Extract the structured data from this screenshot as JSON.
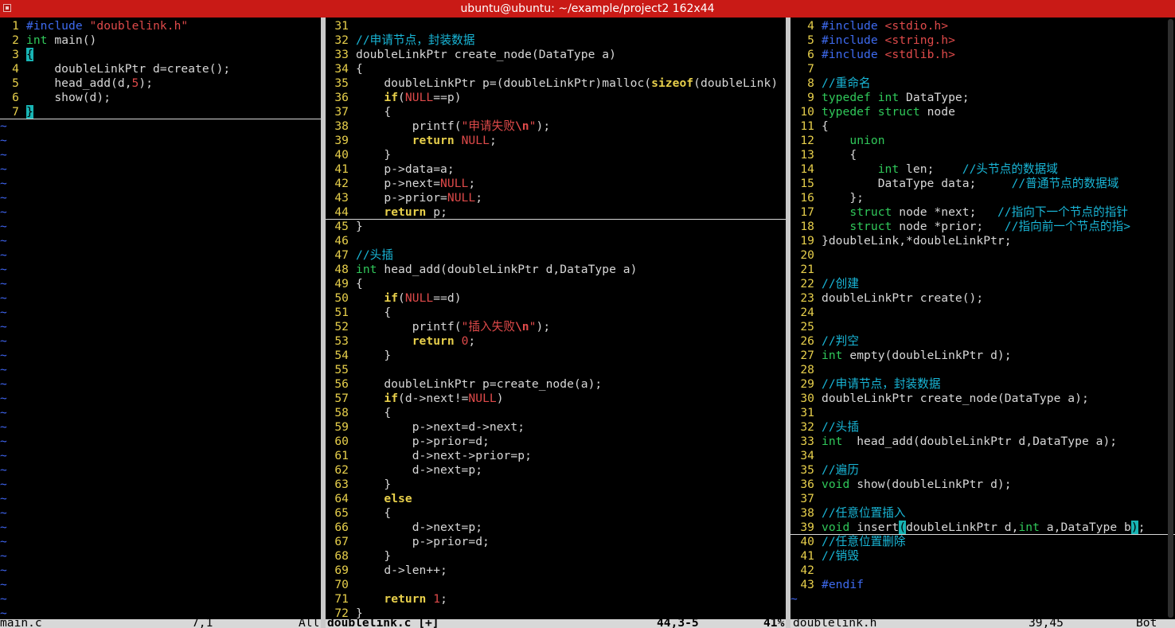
{
  "window": {
    "title": "ubuntu@ubuntu: ~/example/project2 162x44"
  },
  "colors": {
    "titlebar": "#c91a16",
    "number": "#e7cf4b",
    "preproc": "#3e6bf0",
    "keyword": "#e7cf4b",
    "type": "#30c85a",
    "string": "#df4a4a",
    "comment": "#19b7d8",
    "constant": "#df4a4a",
    "tilde": "#3e64f0",
    "cursor": "#18b4b4",
    "default": "#d8d8d8"
  },
  "panes": [
    {
      "id": "main",
      "status": {
        "file": "main.c",
        "pos": "7,1",
        "pct": "All",
        "active": false
      },
      "lines": [
        {
          "n": "1",
          "t": [
            [
              "pp",
              "#include"
            ],
            [
              "d",
              " "
            ],
            [
              "str",
              "\"doublelink.h\""
            ]
          ]
        },
        {
          "n": "2",
          "t": [
            [
              "ty",
              "int"
            ],
            [
              "d",
              " main()"
            ]
          ]
        },
        {
          "n": "3",
          "t": [
            [
              "cur",
              "{"
            ]
          ]
        },
        {
          "n": "4",
          "t": [
            [
              "d",
              "    doubleLinkPtr d=create();"
            ]
          ]
        },
        {
          "n": "5",
          "t": [
            [
              "d",
              "    head_add(d,"
            ],
            [
              "num",
              "5"
            ],
            [
              "d",
              ");"
            ]
          ]
        },
        {
          "n": "6",
          "t": [
            [
              "d",
              "    show(d);"
            ]
          ]
        },
        {
          "n": "7",
          "t": [
            [
              "cur",
              "}"
            ]
          ]
        }
      ]
    },
    {
      "id": "doublelink_c",
      "status": {
        "file": "doublelink.c [+]",
        "pos": "44,3-5",
        "pct": "41%",
        "active": true
      },
      "lines": [
        {
          "n": "31",
          "t": []
        },
        {
          "n": "32",
          "t": [
            [
              "cm",
              "//申请节点，封装数据"
            ]
          ]
        },
        {
          "n": "33",
          "t": [
            [
              "d",
              "doubleLinkPtr create_node(DataType a)"
            ]
          ]
        },
        {
          "n": "34",
          "t": [
            [
              "d",
              "{"
            ]
          ]
        },
        {
          "n": "35",
          "t": [
            [
              "d",
              "    doubleLinkPtr p=(doubleLinkPtr)malloc("
            ],
            [
              "kw",
              "sizeof"
            ],
            [
              "d",
              "(doubleLink)"
            ]
          ]
        },
        {
          "n": "36",
          "t": [
            [
              "d",
              "    "
            ],
            [
              "kw",
              "if"
            ],
            [
              "d",
              "("
            ],
            [
              "cst",
              "NULL"
            ],
            [
              "d",
              "==p)"
            ]
          ]
        },
        {
          "n": "37",
          "t": [
            [
              "d",
              "    {"
            ]
          ]
        },
        {
          "n": "38",
          "t": [
            [
              "d",
              "        printf("
            ],
            [
              "str",
              "\"申请失败"
            ],
            [
              "sp",
              "\\n"
            ],
            [
              "str",
              "\""
            ],
            [
              "d",
              ");"
            ]
          ]
        },
        {
          "n": "39",
          "t": [
            [
              "d",
              "        "
            ],
            [
              "kw",
              "return"
            ],
            [
              "d",
              " "
            ],
            [
              "cst",
              "NULL"
            ],
            [
              "d",
              ";"
            ]
          ]
        },
        {
          "n": "40",
          "t": [
            [
              "d",
              "    }"
            ]
          ]
        },
        {
          "n": "41",
          "t": [
            [
              "d",
              "    p->data=a;"
            ]
          ]
        },
        {
          "n": "42",
          "t": [
            [
              "d",
              "    p->next="
            ],
            [
              "cst",
              "NULL"
            ],
            [
              "d",
              ";"
            ]
          ]
        },
        {
          "n": "43",
          "t": [
            [
              "d",
              "    p->prior="
            ],
            [
              "cst",
              "NULL"
            ],
            [
              "d",
              ";"
            ]
          ]
        },
        {
          "n": "44",
          "t": [
            [
              "d",
              "    "
            ],
            [
              "kw",
              "return"
            ],
            [
              "d",
              " p;"
            ]
          ]
        },
        {
          "n": "45",
          "t": [
            [
              "d",
              "}"
            ]
          ]
        },
        {
          "n": "46",
          "t": []
        },
        {
          "n": "47",
          "t": [
            [
              "cm",
              "//头插"
            ]
          ]
        },
        {
          "n": "48",
          "t": [
            [
              "ty",
              "int"
            ],
            [
              "d",
              " head_add(doubleLinkPtr d,DataType a)"
            ]
          ]
        },
        {
          "n": "49",
          "t": [
            [
              "d",
              "{"
            ]
          ]
        },
        {
          "n": "50",
          "t": [
            [
              "d",
              "    "
            ],
            [
              "kw",
              "if"
            ],
            [
              "d",
              "("
            ],
            [
              "cst",
              "NULL"
            ],
            [
              "d",
              "==d)"
            ]
          ]
        },
        {
          "n": "51",
          "t": [
            [
              "d",
              "    {"
            ]
          ]
        },
        {
          "n": "52",
          "t": [
            [
              "d",
              "        printf("
            ],
            [
              "str",
              "\"插入失败"
            ],
            [
              "sp",
              "\\n"
            ],
            [
              "str",
              "\""
            ],
            [
              "d",
              ");"
            ]
          ]
        },
        {
          "n": "53",
          "t": [
            [
              "d",
              "        "
            ],
            [
              "kw",
              "return"
            ],
            [
              "d",
              " "
            ],
            [
              "num",
              "0"
            ],
            [
              "d",
              ";"
            ]
          ]
        },
        {
          "n": "54",
          "t": [
            [
              "d",
              "    }"
            ]
          ]
        },
        {
          "n": "55",
          "t": []
        },
        {
          "n": "56",
          "t": [
            [
              "d",
              "    doubleLinkPtr p=create_node(a);"
            ]
          ]
        },
        {
          "n": "57",
          "t": [
            [
              "d",
              "    "
            ],
            [
              "kw",
              "if"
            ],
            [
              "d",
              "(d->next!="
            ],
            [
              "cst",
              "NULL"
            ],
            [
              "d",
              ")"
            ]
          ]
        },
        {
          "n": "58",
          "t": [
            [
              "d",
              "    {"
            ]
          ]
        },
        {
          "n": "59",
          "t": [
            [
              "d",
              "        p->next=d->next;"
            ]
          ]
        },
        {
          "n": "60",
          "t": [
            [
              "d",
              "        p->prior=d;"
            ]
          ]
        },
        {
          "n": "61",
          "t": [
            [
              "d",
              "        d->next->prior=p;"
            ]
          ]
        },
        {
          "n": "62",
          "t": [
            [
              "d",
              "        d->next=p;"
            ]
          ]
        },
        {
          "n": "63",
          "t": [
            [
              "d",
              "    }"
            ]
          ]
        },
        {
          "n": "64",
          "t": [
            [
              "d",
              "    "
            ],
            [
              "kw",
              "else"
            ]
          ]
        },
        {
          "n": "65",
          "t": [
            [
              "d",
              "    {"
            ]
          ]
        },
        {
          "n": "66",
          "t": [
            [
              "d",
              "        d->next=p;"
            ]
          ]
        },
        {
          "n": "67",
          "t": [
            [
              "d",
              "        p->prior=d;"
            ]
          ]
        },
        {
          "n": "68",
          "t": [
            [
              "d",
              "    }"
            ]
          ]
        },
        {
          "n": "69",
          "t": [
            [
              "d",
              "    d->len++;"
            ]
          ]
        },
        {
          "n": "70",
          "t": []
        },
        {
          "n": "71",
          "t": [
            [
              "d",
              "    "
            ],
            [
              "kw",
              "return"
            ],
            [
              "d",
              " "
            ],
            [
              "num",
              "1"
            ],
            [
              "d",
              ";"
            ]
          ]
        },
        {
          "n": "72",
          "t": [
            [
              "d",
              "}"
            ]
          ]
        }
      ]
    },
    {
      "id": "doublelink_h",
      "status": {
        "file": "doublelink.h",
        "pos": "39,45",
        "pct": "Bot",
        "active": false
      },
      "lines": [
        {
          "n": "4",
          "t": [
            [
              "pp",
              "#include"
            ],
            [
              "d",
              " "
            ],
            [
              "str",
              "<stdio.h>"
            ]
          ]
        },
        {
          "n": "5",
          "t": [
            [
              "pp",
              "#include"
            ],
            [
              "d",
              " "
            ],
            [
              "str",
              "<string.h>"
            ]
          ]
        },
        {
          "n": "6",
          "t": [
            [
              "pp",
              "#include"
            ],
            [
              "d",
              " "
            ],
            [
              "str",
              "<stdlib.h>"
            ]
          ]
        },
        {
          "n": "7",
          "t": []
        },
        {
          "n": "8",
          "t": [
            [
              "cm",
              "//重命名"
            ]
          ]
        },
        {
          "n": "9",
          "t": [
            [
              "ty",
              "typedef"
            ],
            [
              "d",
              " "
            ],
            [
              "ty",
              "int"
            ],
            [
              "d",
              " DataType;"
            ]
          ]
        },
        {
          "n": "10",
          "t": [
            [
              "ty",
              "typedef"
            ],
            [
              "d",
              " "
            ],
            [
              "ty",
              "struct"
            ],
            [
              "d",
              " node"
            ]
          ]
        },
        {
          "n": "11",
          "t": [
            [
              "d",
              "{"
            ]
          ]
        },
        {
          "n": "12",
          "t": [
            [
              "d",
              "    "
            ],
            [
              "ty",
              "union"
            ]
          ]
        },
        {
          "n": "13",
          "t": [
            [
              "d",
              "    {"
            ]
          ]
        },
        {
          "n": "14",
          "t": [
            [
              "d",
              "        "
            ],
            [
              "ty",
              "int"
            ],
            [
              "d",
              " len;    "
            ],
            [
              "cm",
              "//头节点的数据域"
            ]
          ]
        },
        {
          "n": "15",
          "t": [
            [
              "d",
              "        DataType data;     "
            ],
            [
              "cm",
              "//普通节点的数据域"
            ]
          ]
        },
        {
          "n": "16",
          "t": [
            [
              "d",
              "    };"
            ]
          ]
        },
        {
          "n": "17",
          "t": [
            [
              "d",
              "    "
            ],
            [
              "ty",
              "struct"
            ],
            [
              "d",
              " node *next;   "
            ],
            [
              "cm",
              "//指向下一个节点的指针"
            ]
          ]
        },
        {
          "n": "18",
          "t": [
            [
              "d",
              "    "
            ],
            [
              "ty",
              "struct"
            ],
            [
              "d",
              " node *prior;   "
            ],
            [
              "cm",
              "//指向前一个节点的指>"
            ]
          ]
        },
        {
          "n": "19",
          "t": [
            [
              "d",
              "}doubleLink,*doubleLinkPtr;"
            ]
          ]
        },
        {
          "n": "20",
          "t": []
        },
        {
          "n": "21",
          "t": []
        },
        {
          "n": "22",
          "t": [
            [
              "cm",
              "//创建"
            ]
          ]
        },
        {
          "n": "23",
          "t": [
            [
              "d",
              "doubleLinkPtr create();"
            ]
          ]
        },
        {
          "n": "24",
          "t": []
        },
        {
          "n": "25",
          "t": []
        },
        {
          "n": "26",
          "t": [
            [
              "cm",
              "//判空"
            ]
          ]
        },
        {
          "n": "27",
          "t": [
            [
              "ty",
              "int"
            ],
            [
              "d",
              " empty(doubleLinkPtr d);"
            ]
          ]
        },
        {
          "n": "28",
          "t": []
        },
        {
          "n": "29",
          "t": [
            [
              "cm",
              "//申请节点，封装数据"
            ]
          ]
        },
        {
          "n": "30",
          "t": [
            [
              "d",
              "doubleLinkPtr create_node(DataType a);"
            ]
          ]
        },
        {
          "n": "31",
          "t": []
        },
        {
          "n": "32",
          "t": [
            [
              "cm",
              "//头插"
            ]
          ]
        },
        {
          "n": "33",
          "t": [
            [
              "ty",
              "int"
            ],
            [
              "d",
              "  head_add(doubleLinkPtr d,DataType a);"
            ]
          ]
        },
        {
          "n": "34",
          "t": []
        },
        {
          "n": "35",
          "t": [
            [
              "cm",
              "//遍历"
            ]
          ]
        },
        {
          "n": "36",
          "t": [
            [
              "ty",
              "void"
            ],
            [
              "d",
              " show(doubleLinkPtr d);"
            ]
          ]
        },
        {
          "n": "37",
          "t": []
        },
        {
          "n": "38",
          "t": [
            [
              "cm",
              "//任意位置插入"
            ]
          ]
        },
        {
          "n": "39",
          "t": [
            [
              "ty",
              "void"
            ],
            [
              "d",
              " insert"
            ],
            [
              "cur",
              "("
            ],
            [
              "d",
              "doubleLinkPtr d,"
            ],
            [
              "ty",
              "int"
            ],
            [
              "d",
              " a,DataType b"
            ],
            [
              "cur",
              ")"
            ],
            [
              "d",
              ";"
            ]
          ]
        },
        {
          "n": "40",
          "t": [
            [
              "cm",
              "//任意位置删除"
            ]
          ]
        },
        {
          "n": "41",
          "t": [
            [
              "cm",
              "//销毁"
            ]
          ]
        },
        {
          "n": "42",
          "t": []
        },
        {
          "n": "43",
          "t": [
            [
              "pp",
              "#endif"
            ]
          ]
        }
      ]
    }
  ]
}
